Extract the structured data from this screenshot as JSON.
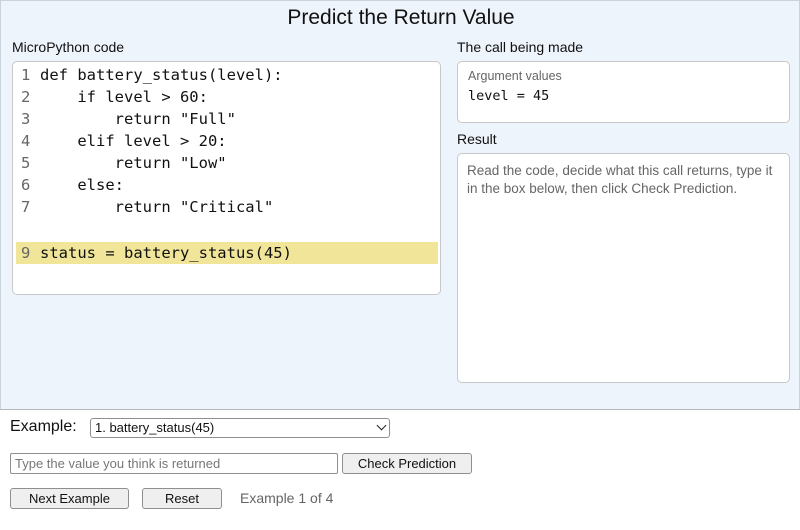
{
  "title": "Predict the Return Value",
  "code_panel": {
    "label": "MicroPython code",
    "lines": [
      {
        "num": "1",
        "text": "def battery_status(level):"
      },
      {
        "num": "2",
        "text": "    if level > 60:"
      },
      {
        "num": "3",
        "text": "        return \"Full\""
      },
      {
        "num": "4",
        "text": "    elif level > 20:"
      },
      {
        "num": "5",
        "text": "        return \"Low\""
      },
      {
        "num": "6",
        "text": "    else:"
      },
      {
        "num": "7",
        "text": "        return \"Critical\""
      },
      {
        "num": "9",
        "text": "status = battery_status(45)"
      }
    ],
    "highlight_color": "#f0e598"
  },
  "call_panel": {
    "label": "The call being made",
    "arg_header": "Argument values",
    "arg_value": "level = 45"
  },
  "result_panel": {
    "label": "Result",
    "text": "Read the code, decide what this call returns, type it in the box below, then click Check Prediction."
  },
  "controls": {
    "example_label": "Example:",
    "example_selected": "1. battery_status(45)",
    "guess_placeholder": "Type the value you think is returned",
    "guess_value": "",
    "check_label": "Check Prediction",
    "next_label": "Next Example",
    "reset_label": "Reset",
    "counter": "Example 1 of 4"
  },
  "colors": {
    "panel_bg": "#eef4fc",
    "highlight": "#f0e598"
  }
}
